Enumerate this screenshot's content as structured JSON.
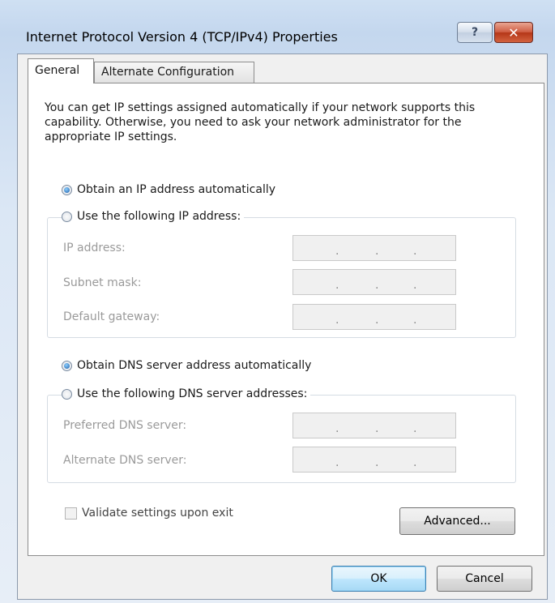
{
  "window": {
    "title": "Internet Protocol Version 4 (TCP/IPv4) Properties",
    "help_label": "?",
    "close_label": "✕"
  },
  "tabs": [
    {
      "label": "General",
      "selected": true
    },
    {
      "label": "Alternate Configuration",
      "selected": false
    }
  ],
  "general": {
    "description": "You can get IP settings assigned automatically if your network supports this capability. Otherwise, you need to ask your network administrator for the appropriate IP settings.",
    "ip": {
      "auto_label": "Obtain an IP address automatically",
      "auto_checked": true,
      "manual_label": "Use the following IP address:",
      "manual_checked": false,
      "fields": [
        {
          "label": "IP address:",
          "value": ""
        },
        {
          "label": "Subnet mask:",
          "value": ""
        },
        {
          "label": "Default gateway:",
          "value": ""
        }
      ]
    },
    "dns": {
      "auto_label": "Obtain DNS server address automatically",
      "auto_checked": true,
      "manual_label": "Use the following DNS server addresses:",
      "manual_checked": false,
      "fields": [
        {
          "label": "Preferred DNS server:",
          "value": ""
        },
        {
          "label": "Alternate DNS server:",
          "value": ""
        }
      ]
    },
    "validate_label": "Validate settings upon exit",
    "validate_checked": false,
    "validate_enabled": false,
    "advanced_label": "Advanced..."
  },
  "footer": {
    "ok_label": "OK",
    "cancel_label": "Cancel"
  },
  "colors": {
    "titlebar": "#c4d7ee",
    "close_button": "#c4472a",
    "ok_border": "#3c7fb1",
    "disabled_text": "#9a9a9a"
  }
}
